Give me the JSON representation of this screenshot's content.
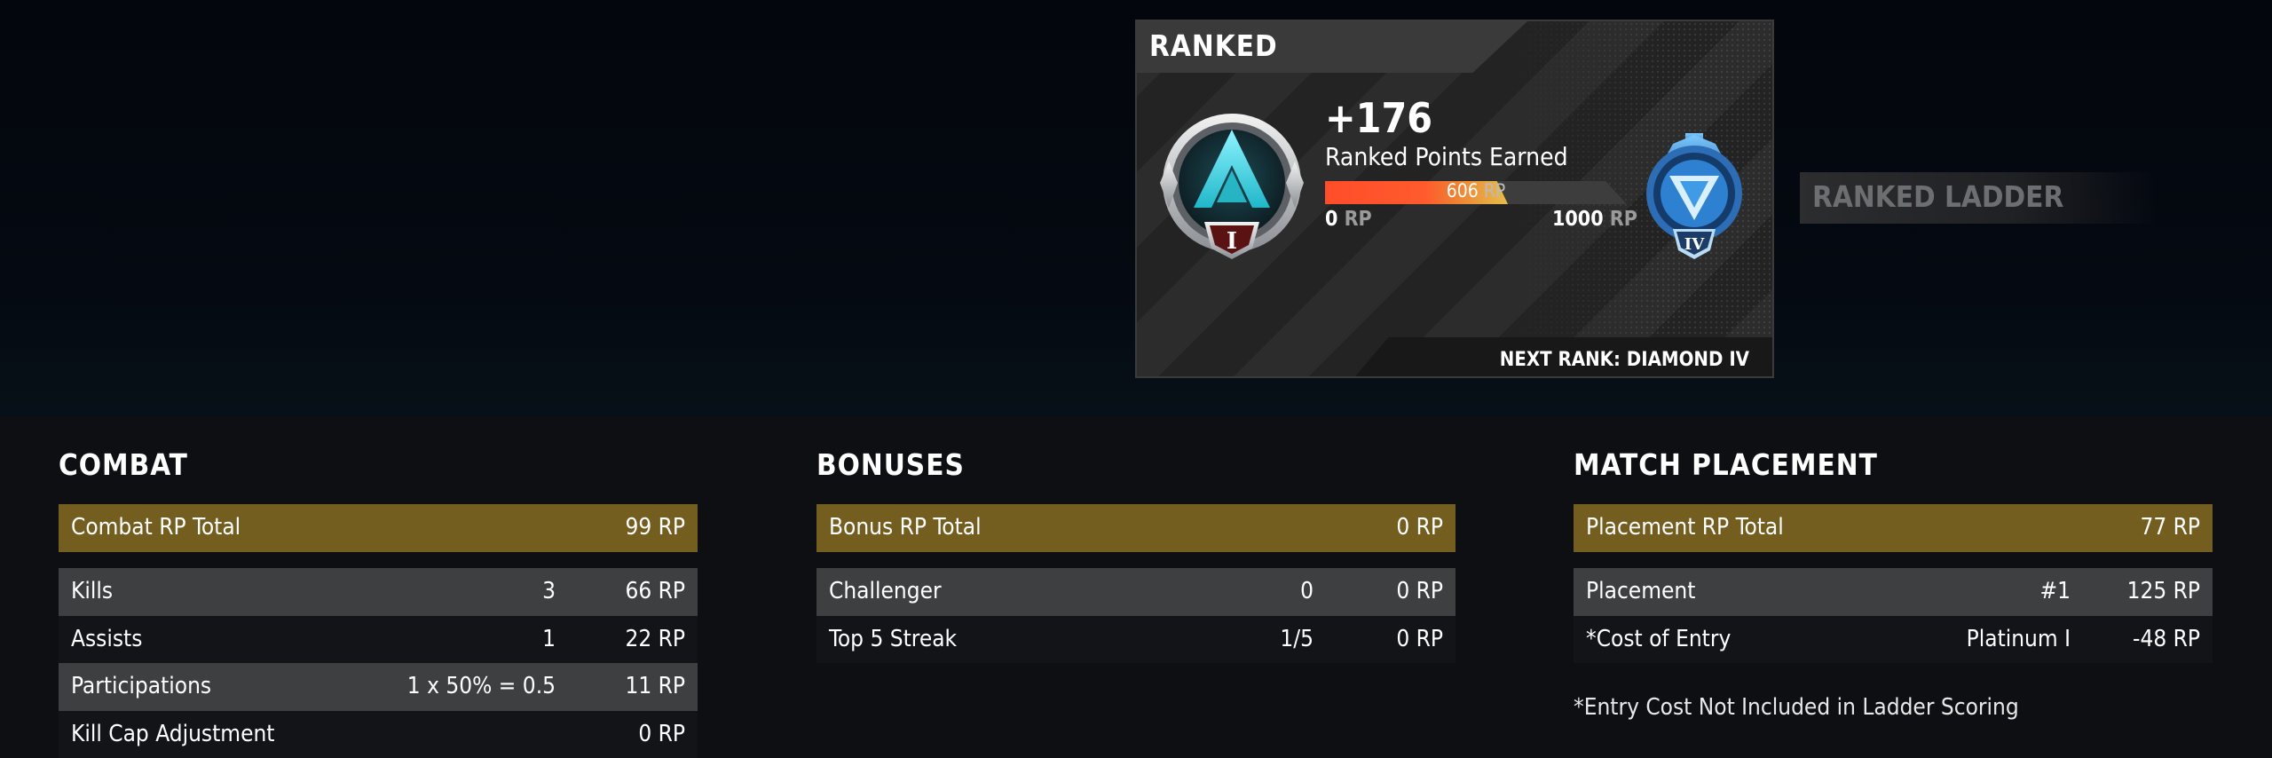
{
  "ranked_card": {
    "title": "RANKED",
    "points_gained": "+176",
    "points_label": "Ranked Points Earned",
    "current_rp": "606",
    "rp_unit": "RP",
    "progress_fraction": 0.606,
    "min_rp": "0",
    "max_rp": "1000",
    "next_rank": "NEXT RANK: DIAMOND IV",
    "current_tier_numeral": "I",
    "next_tier_numeral": "IV"
  },
  "ranked_ladder_button": "RANKED LADDER",
  "combat": {
    "title": "COMBAT",
    "total_label": "Combat RP Total",
    "total_value": "99 RP",
    "rows": [
      {
        "label": "Kills",
        "detail": "3",
        "value": "66 RP"
      },
      {
        "label": "Assists",
        "detail": "1",
        "value": "22 RP"
      },
      {
        "label": "Participations",
        "detail": "1 x 50% = 0.5",
        "value": "11 RP"
      },
      {
        "label": "Kill Cap Adjustment",
        "detail": "",
        "value": "0 RP"
      }
    ]
  },
  "bonuses": {
    "title": "BONUSES",
    "total_label": "Bonus RP Total",
    "total_value": "0 RP",
    "rows": [
      {
        "label": "Challenger",
        "detail": "0",
        "value": "0 RP"
      },
      {
        "label": "Top 5 Streak",
        "detail": "1/5",
        "value": "0 RP"
      }
    ]
  },
  "placement": {
    "title": "MATCH PLACEMENT",
    "total_label": "Placement RP Total",
    "total_value": "77 RP",
    "rows": [
      {
        "label": "Placement",
        "detail": "#1",
        "value": "125 RP"
      },
      {
        "label": "*Cost of Entry",
        "detail": "Platinum I",
        "value": "-48 RP"
      }
    ],
    "note": "*Entry Cost Not Included in Ladder Scoring"
  },
  "colors": {
    "total_bar": "#735d1f",
    "progress_start": "#ff4d2a",
    "progress_end": "#e6be4a"
  },
  "icons": [
    "platinum-rank-badge-icon",
    "diamond-rank-badge-icon"
  ]
}
